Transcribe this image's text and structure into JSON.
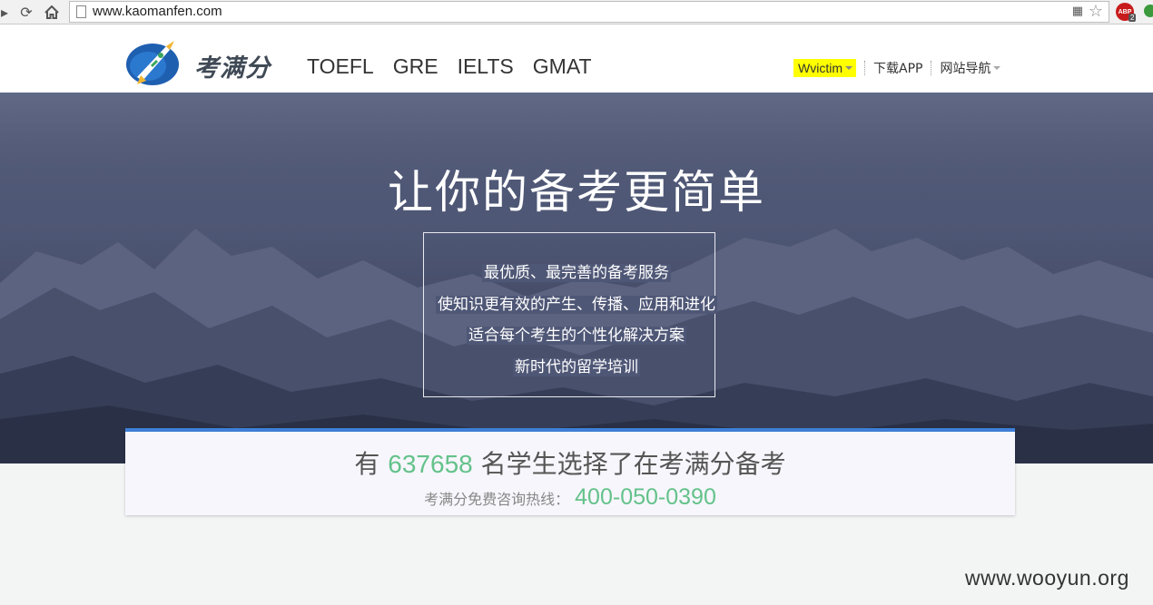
{
  "browser": {
    "url": "www.kaomanfen.com",
    "abp_label": "ABP",
    "abp_badge": "2"
  },
  "header": {
    "logo_text": "考满分",
    "nav": [
      "TOEFL",
      "GRE",
      "IELTS",
      "GMAT"
    ],
    "user_name": "Wvictim",
    "download_app": "下载APP",
    "site_nav": "网站导航"
  },
  "hero": {
    "title": "让你的备考更简单",
    "lines": [
      "最优质、最完善的备考服务",
      "使知识更有效的产生、传播、应用和进化",
      "适合每个考生的个性化解决方案",
      "新时代的留学培训"
    ]
  },
  "stats": {
    "prefix": "有",
    "count": "637658",
    "suffix": "名学生选择了在考满分备考",
    "hotline_label": "考满分免费咨询热线：",
    "hotline": "400-050-0390"
  },
  "watermark": "www.wooyun.org",
  "colors": {
    "accent_green": "#64c28a",
    "card_top_border": "#3f7fd6",
    "highlight": "#ffff00"
  }
}
